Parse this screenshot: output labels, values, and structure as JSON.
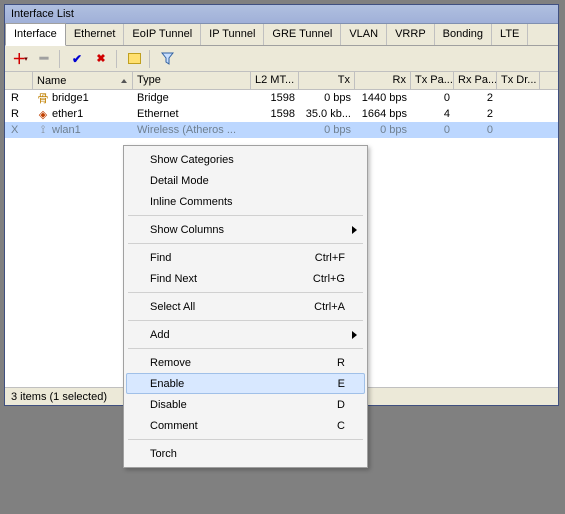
{
  "window": {
    "title": "Interface List"
  },
  "tabs": [
    "Interface",
    "Ethernet",
    "EoIP Tunnel",
    "IP Tunnel",
    "GRE Tunnel",
    "VLAN",
    "VRRP",
    "Bonding",
    "LTE"
  ],
  "columns": [
    "Name",
    "Type",
    "L2 MT...",
    "Tx",
    "Rx",
    "Tx Pa...",
    "Rx Pa...",
    "Tx Dr..."
  ],
  "rows": [
    {
      "flag": "R",
      "icon": "bridge",
      "name": "bridge1",
      "type": "Bridge",
      "l2": "1598",
      "tx": "0 bps",
      "rx": "1440 bps",
      "txp": "0",
      "rxp": "2",
      "sel": false
    },
    {
      "flag": "R",
      "icon": "ether",
      "name": "ether1",
      "type": "Ethernet",
      "l2": "1598",
      "tx": "35.0 kb...",
      "rx": "1664 bps",
      "txp": "4",
      "rxp": "2",
      "sel": false
    },
    {
      "flag": "X",
      "icon": "wlan",
      "name": "wlan1",
      "type": "Wireless (Atheros ...",
      "l2": "",
      "tx": "0 bps",
      "rx": "0 bps",
      "txp": "0",
      "rxp": "0",
      "sel": true
    }
  ],
  "status": "3 items (1 selected)",
  "menu": [
    {
      "t": "item",
      "label": "Show Categories"
    },
    {
      "t": "item",
      "label": "Detail Mode"
    },
    {
      "t": "item",
      "label": "Inline Comments"
    },
    {
      "t": "sep"
    },
    {
      "t": "sub",
      "label": "Show Columns"
    },
    {
      "t": "sep"
    },
    {
      "t": "item",
      "label": "Find",
      "sc": "Ctrl+F"
    },
    {
      "t": "item",
      "label": "Find Next",
      "sc": "Ctrl+G"
    },
    {
      "t": "sep"
    },
    {
      "t": "item",
      "label": "Select All",
      "sc": "Ctrl+A"
    },
    {
      "t": "sep"
    },
    {
      "t": "sub",
      "label": "Add"
    },
    {
      "t": "sep"
    },
    {
      "t": "item",
      "label": "Remove",
      "sc": "R"
    },
    {
      "t": "item",
      "label": "Enable",
      "sc": "E",
      "hov": true
    },
    {
      "t": "item",
      "label": "Disable",
      "sc": "D"
    },
    {
      "t": "item",
      "label": "Comment",
      "sc": "C"
    },
    {
      "t": "sep"
    },
    {
      "t": "item",
      "label": "Torch"
    }
  ]
}
